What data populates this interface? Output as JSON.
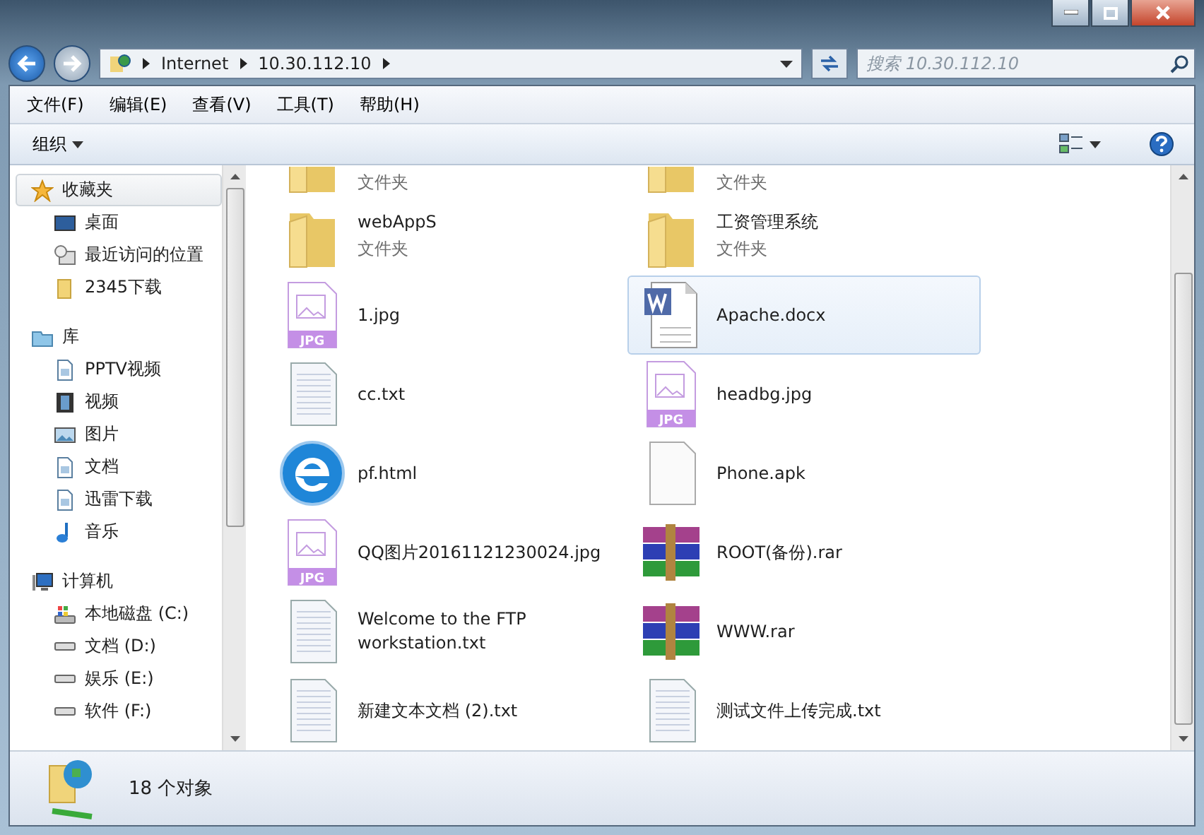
{
  "address_bar": {
    "crumbs": [
      "Internet",
      "10.30.112.10"
    ]
  },
  "search": {
    "placeholder": "搜索 10.30.112.10"
  },
  "menu": [
    "文件(F)",
    "编辑(E)",
    "查看(V)",
    "工具(T)",
    "帮助(H)"
  ],
  "toolbar": {
    "organize": "组织"
  },
  "sidebar": {
    "groups": [
      {
        "label": "收藏夹",
        "kind": "star",
        "selected": true,
        "children": [
          {
            "label": "桌面",
            "kind": "desktop"
          },
          {
            "label": "最近访问的位置",
            "kind": "recent"
          },
          {
            "label": "2345下载",
            "kind": "folder"
          }
        ]
      },
      {
        "label": "库",
        "kind": "library",
        "selected": false,
        "children": [
          {
            "label": "PPTV视频",
            "kind": "doc"
          },
          {
            "label": "视频",
            "kind": "film"
          },
          {
            "label": "图片",
            "kind": "picture"
          },
          {
            "label": "文档",
            "kind": "doc"
          },
          {
            "label": "迅雷下载",
            "kind": "doc"
          },
          {
            "label": "音乐",
            "kind": "music"
          }
        ]
      },
      {
        "label": "计算机",
        "kind": "computer",
        "selected": false,
        "children": [
          {
            "label": "本地磁盘 (C:)",
            "kind": "sysdrive"
          },
          {
            "label": "文档 (D:)",
            "kind": "drive"
          },
          {
            "label": "娱乐 (E:)",
            "kind": "drive"
          },
          {
            "label": "软件 (F:)",
            "kind": "drive"
          }
        ]
      }
    ]
  },
  "files": [
    {
      "kind": "folder",
      "type": "文件夹",
      "partial": true,
      "selected": false
    },
    {
      "kind": "folder",
      "type": "文件夹",
      "partial": true,
      "selected": false
    },
    {
      "kind": "folder",
      "name": "webAppS",
      "type": "文件夹",
      "selected": false
    },
    {
      "kind": "folder",
      "name": "工资管理系统",
      "type": "文件夹",
      "selected": false
    },
    {
      "kind": "jpg",
      "name": "1.jpg",
      "badge": "JPG",
      "selected": false
    },
    {
      "kind": "word",
      "name": "Apache.docx",
      "selected": true
    },
    {
      "kind": "txt",
      "name": "cc.txt",
      "selected": false
    },
    {
      "kind": "jpg",
      "name": "headbg.jpg",
      "badge": "JPG",
      "selected": false
    },
    {
      "kind": "ie",
      "name": "pf.html",
      "selected": false
    },
    {
      "kind": "blank",
      "name": "Phone.apk",
      "selected": false
    },
    {
      "kind": "jpg",
      "name": "QQ图片20161121230024.jpg",
      "badge": "JPG",
      "selected": false
    },
    {
      "kind": "rar",
      "name": "ROOT(备份).rar",
      "selected": false
    },
    {
      "kind": "txt",
      "name": "Welcome to the FTP workstation.txt",
      "selected": false
    },
    {
      "kind": "rar",
      "name": "WWW.rar",
      "selected": false
    },
    {
      "kind": "txt",
      "name": "新建文本文档 (2).txt",
      "selected": false
    },
    {
      "kind": "txt",
      "name": "测试文件上传完成.txt",
      "selected": false
    }
  ],
  "status_bar": {
    "count": "18 个对象"
  }
}
